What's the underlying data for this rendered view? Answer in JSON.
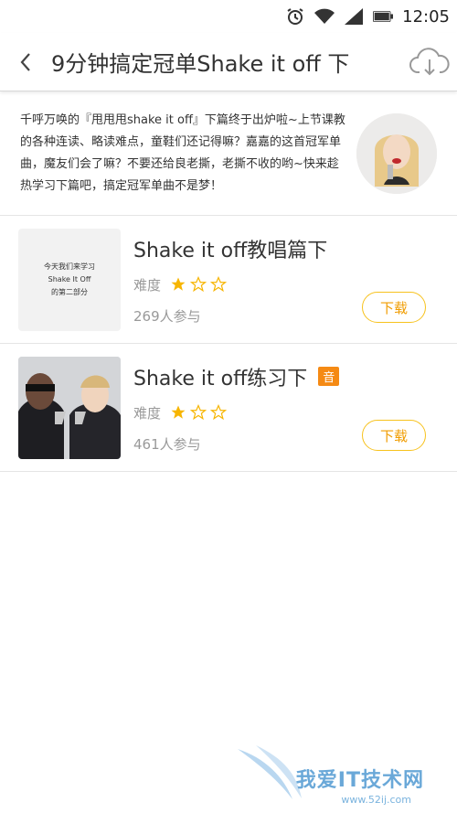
{
  "status_bar": {
    "time": "12:05"
  },
  "header": {
    "title": "9分钟搞定冠单Shake it off 下"
  },
  "intro": {
    "text": "千呼万唤的『甩甩甩shake it off』下篇终于出炉啦~上节课教的各种连读、略读难点，童鞋们还记得嘛？嘉嘉的这首冠军单曲，魔友们会了嘛？不要还给良老撕，老撕不收的哟~快来趁热学习下篇吧，搞定冠军单曲不是梦！"
  },
  "courses": [
    {
      "thumb_lines": [
        "今天我们来学习",
        "Shake It Off",
        "的第二部分"
      ],
      "title": "Shake it off教唱篇下",
      "badge": "",
      "difficulty_label": "难度",
      "rating": 1,
      "rating_max": 3,
      "participants": "269人参与",
      "download_label": "下载"
    },
    {
      "title": "Shake it off练习下",
      "badge": "音",
      "difficulty_label": "难度",
      "rating": 1,
      "rating_max": 3,
      "participants": "461人参与",
      "download_label": "下载"
    }
  ],
  "watermark": {
    "text": "我爱IT技术网",
    "url": "www.52ij.com"
  },
  "colors": {
    "accent": "#f7c21d",
    "badge": "#f58a14",
    "star": "#f7b500"
  }
}
